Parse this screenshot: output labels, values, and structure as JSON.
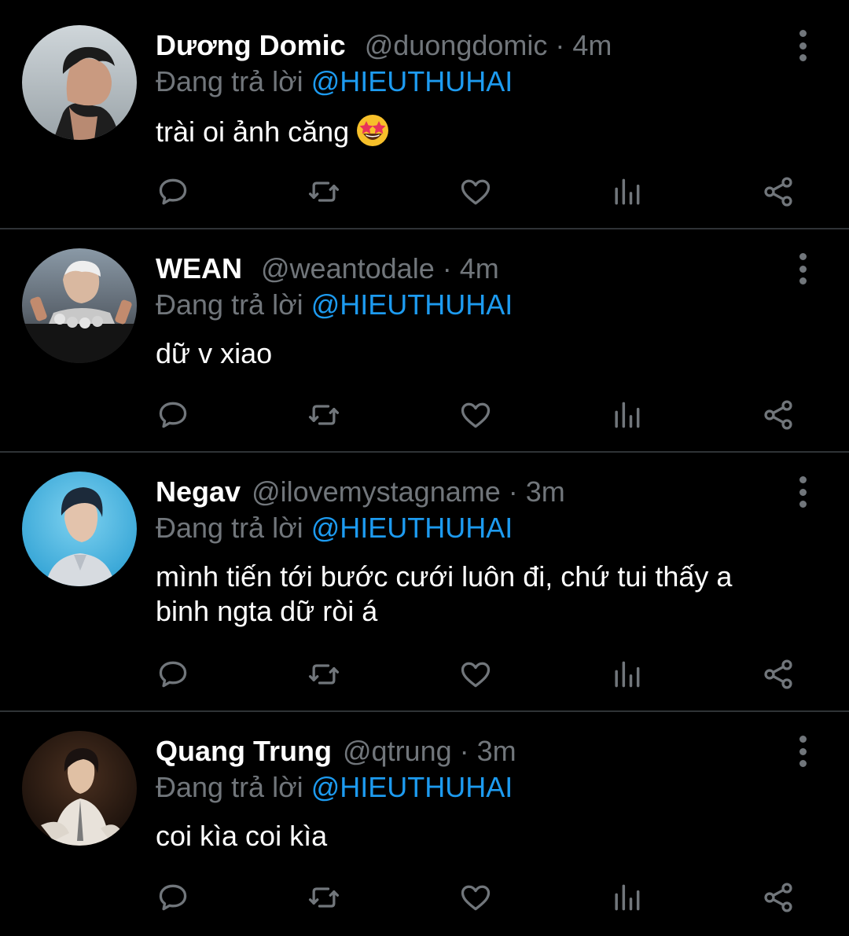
{
  "reply_prefix": "Đang trả lời",
  "dot": "·",
  "colors": {
    "background": "#000000",
    "name": "#ffffff",
    "meta": "#71767b",
    "mention": "#1d9bf0",
    "divider": "#2f3336"
  },
  "icons": {
    "reply": "reply-icon",
    "retweet": "retweet-icon",
    "like": "heart-icon",
    "views": "analytics-icon",
    "share": "share-icon",
    "more": "more-vertical-icon"
  },
  "tweets": [
    {
      "name": "Dương Domic",
      "handle": "@duongdomic",
      "time": "4m",
      "reply_to": "@HIEUTHUHAI",
      "text": "trài oi ảnh căng",
      "emoji": "star-struck-emoji"
    },
    {
      "name": "WEAN",
      "handle": "@weantodale",
      "time": "4m",
      "reply_to": "@HIEUTHUHAI",
      "text": "dữ v xiao"
    },
    {
      "name": "Negav",
      "handle": "@ilovemystagname",
      "time": "3m",
      "reply_to": "@HIEUTHUHAI",
      "text": "mình tiến tới bước cưới luôn đi, chứ tui thấy a binh ngta dữ ròi á"
    },
    {
      "name": "Quang Trung",
      "handle": "@qtrung",
      "time": "3m",
      "reply_to": "@HIEUTHUHAI",
      "text": "coi kìa coi kìa"
    }
  ]
}
